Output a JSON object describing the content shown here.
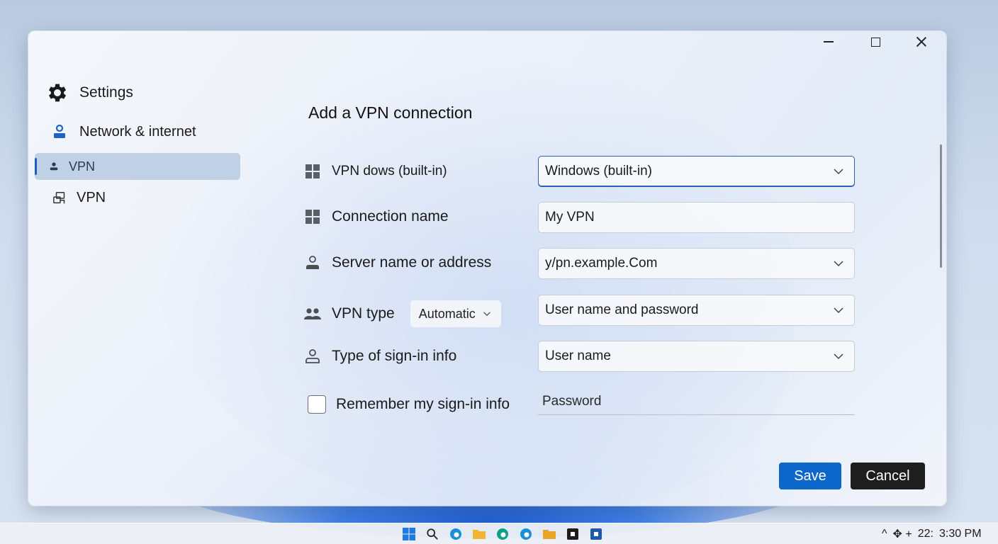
{
  "window": {
    "minimize_icon": "minimize-icon",
    "maximize_icon": "maximize-icon",
    "close_icon": "close-icon"
  },
  "sidebar": {
    "app_title": "Settings",
    "items": [
      {
        "label": "Network & internet",
        "icon": "network-icon"
      },
      {
        "label": "VPN",
        "icon": "person-icon",
        "selected": true
      },
      {
        "label": "VPN",
        "icon": "vpn-icon"
      }
    ]
  },
  "main": {
    "title": "Add a VPN connection",
    "rows": [
      {
        "label": "VPN dows (built-in)",
        "icon": "windows-icon",
        "value": "Windows (built-in)",
        "control": "dropdown"
      },
      {
        "label": "Connection name",
        "icon": "windows-icon",
        "value": "My VPN",
        "control": "text"
      },
      {
        "label": "Server name or address",
        "icon": "person-icon",
        "value": "y/pn.example.Com",
        "control": "dropdown"
      },
      {
        "label": "VPN type",
        "icon": "people-icon",
        "mini_select": "Automatic",
        "value": "User name and password",
        "control": "dropdown"
      },
      {
        "label": "Type of sign-in info",
        "icon": "person-outline-icon",
        "value": "User name",
        "control": "dropdown"
      },
      {
        "label": "Remember my sign-in info",
        "checked": false,
        "placeholder": "Password",
        "control": "password"
      }
    ],
    "save_label": "Save",
    "cancel_label": "Cancel"
  },
  "taskbar": {
    "icons": [
      "start-icon",
      "search-icon",
      "edge-icon",
      "file-explorer-icon",
      "edge-icon",
      "edge-icon",
      "folder-icon",
      "app-icon",
      "app-icon"
    ],
    "tray_chevron": "^",
    "tray_symbols": "✥ +",
    "tray_extra": "22:",
    "time": "3:30 PM"
  },
  "colors": {
    "accent": "#0d66c9",
    "selected_bg": "#b0c4de",
    "cancel_bg": "#1e1e1e",
    "focus_border": "#2b5fb0"
  }
}
